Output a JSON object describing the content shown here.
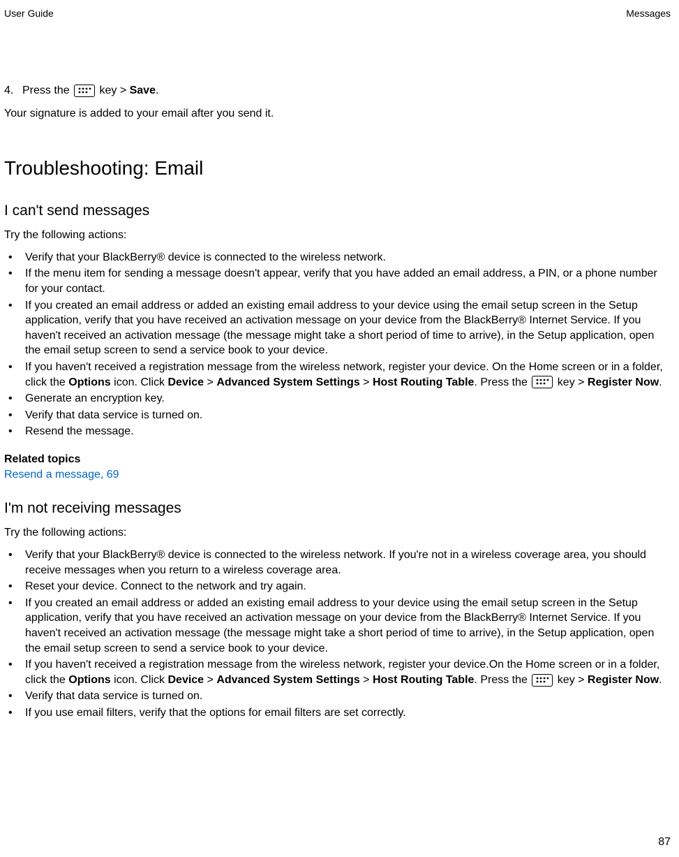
{
  "header": {
    "left": "User Guide",
    "right": "Messages"
  },
  "step4": {
    "num": "4.",
    "pre": "Press the ",
    "post": " key > ",
    "save": "Save",
    "end": "."
  },
  "sig_note": "Your signature is added to your email after you send it.",
  "h1": "Troubleshooting: Email",
  "sec1": {
    "title": "I can't send messages",
    "intro": "Try the following actions:",
    "b1": "Verify that your BlackBerry® device is connected to the wireless network.",
    "b2": "If the menu item for sending a message doesn't appear, verify that you have added an email address, a PIN, or a phone number for your contact.",
    "b3": "If you created an email address or added an existing email address to your device using the email setup screen in the Setup application, verify that you have received an activation message on your device from the BlackBerry® Internet Service. If you haven't received an activation message (the message might take a short period of time to arrive), in the Setup application, open the email setup screen to send a service book to your device.",
    "b4": {
      "p1": "If you haven't received a registration message from the wireless network, register your device. On the Home screen or in a folder, click the ",
      "options": "Options",
      "p2": " icon. Click ",
      "device": "Device",
      "gt1": " > ",
      "adv": "Advanced System Settings",
      "gt2": " > ",
      "host": "Host Routing Table",
      "p3": ". Press the ",
      "p4": " key > ",
      "reg": "Register Now",
      "p5": "."
    },
    "b5": "Generate an encryption key.",
    "b6": "Verify that data service is turned on.",
    "b7": "Resend the message."
  },
  "related": {
    "label": "Related topics",
    "link": "Resend a message, 69"
  },
  "sec2": {
    "title": "I'm not receiving messages",
    "intro": "Try the following actions:",
    "b1": "Verify that your BlackBerry® device is connected to the wireless network. If you're not in a wireless coverage area, you should receive messages when you return to a wireless coverage area.",
    "b2": "Reset your device. Connect to the network and try again.",
    "b3": "If you created an email address or added an existing email address to your device using the email setup screen in the Setup application, verify that you have received an activation message on your device from the BlackBerry® Internet Service. If you haven't received an activation message (the message might take a short period of time to arrive), in the Setup application, open the email setup screen to send a service book to your device.",
    "b4": {
      "p1": "If you haven't received a registration message from the wireless network, register your device.On the Home screen or in a folder, click the ",
      "options": "Options",
      "p2": " icon. Click ",
      "device": "Device",
      "gt1": " > ",
      "adv": "Advanced System Settings",
      "gt2": " > ",
      "host": "Host Routing Table",
      "p3": ". Press the ",
      "p4": " key > ",
      "reg": "Register Now",
      "p5": "."
    },
    "b5": "Verify that data service is turned on.",
    "b6": "If you use email filters, verify that the options for email filters are set correctly."
  },
  "page_num": "87"
}
